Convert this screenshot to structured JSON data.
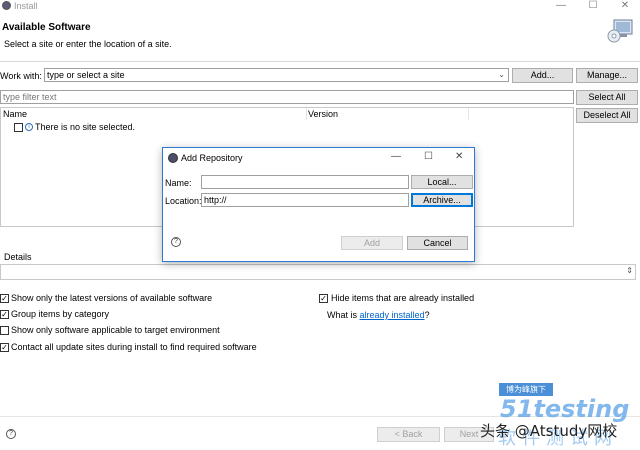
{
  "window": {
    "title": "Install",
    "minimize": "—",
    "maximize": "☐",
    "close": "✕"
  },
  "header": {
    "title": "Available Software",
    "subtitle": "Select a site or enter the location of a site."
  },
  "work_with": {
    "label": "Work with:",
    "placeholder": "type or select a site",
    "add_button": "Add...",
    "manage_button": "Manage..."
  },
  "filter": {
    "placeholder": "type filter text",
    "select_all": "Select All",
    "deselect_all": "Deselect All"
  },
  "table": {
    "columns": [
      "Name",
      "Version"
    ],
    "empty_message": "There is no site selected."
  },
  "details": {
    "label": "Details"
  },
  "options": {
    "latest_versions": {
      "label": "Show only the latest versions of available software",
      "checked": true
    },
    "group_by_category": {
      "label": "Group items by category",
      "checked": true
    },
    "applicable_only": {
      "label": "Show only software applicable to target environment",
      "checked": false
    },
    "contact_all": {
      "label": "Contact all update sites during install to find required software",
      "checked": true
    },
    "hide_installed": {
      "label": "Hide items that are already installed",
      "checked": true
    },
    "what_is_prefix": "What is",
    "what_is_link": "already installed",
    "what_is_suffix": "?"
  },
  "footer": {
    "back_button": "< Back",
    "next_button": "Next"
  },
  "dialog": {
    "title": "Add Repository",
    "name_label": "Name:",
    "name_value": "",
    "location_label": "Location:",
    "location_value": "http://",
    "local_button": "Local...",
    "archive_button": "Archive...",
    "add_button": "Add",
    "cancel_button": "Cancel",
    "minimize": "—",
    "maximize": "☐",
    "close": "✕"
  },
  "watermark": {
    "badge": "博为峰旗下",
    "brand": "51testing",
    "sub": "软件测试网",
    "credit": "头条 @Atstudy网校"
  }
}
